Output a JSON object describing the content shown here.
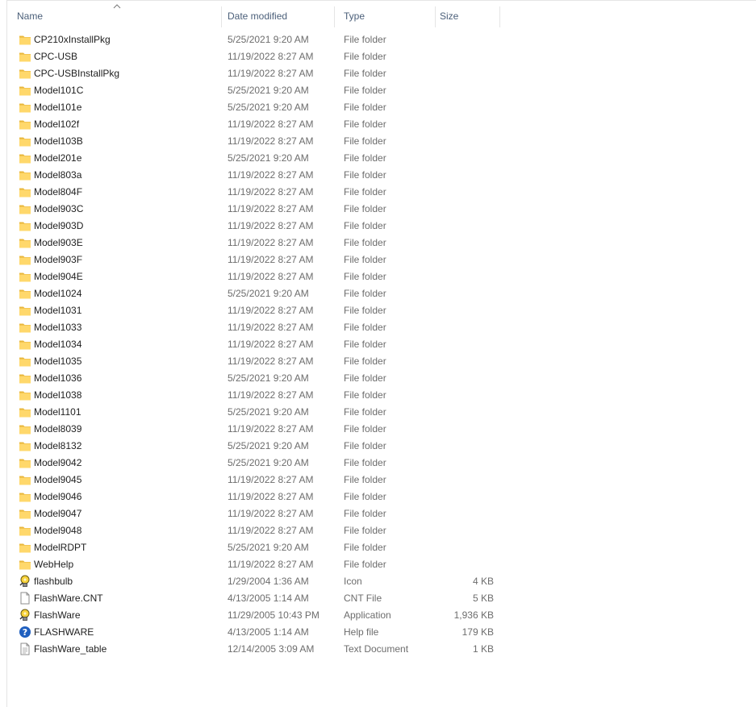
{
  "columns": {
    "name": "Name",
    "date": "Date modified",
    "type": "Type",
    "size": "Size"
  },
  "sort": {
    "column": "name",
    "direction": "ascending",
    "icon": "sort-up-arrow-icon"
  },
  "colors": {
    "header_text": "#4c607a",
    "name_text": "#1e1e1e",
    "detail_text": "#6d6d6d",
    "folder_fill": "#ffd86b",
    "folder_dark": "#e8b73c"
  },
  "files": [
    {
      "name": "CP210xInstallPkg",
      "date": "5/25/2021 9:20 AM",
      "type": "File folder",
      "size": "",
      "icon": "folder"
    },
    {
      "name": "CPC-USB",
      "date": "11/19/2022 8:27 AM",
      "type": "File folder",
      "size": "",
      "icon": "folder"
    },
    {
      "name": "CPC-USBInstallPkg",
      "date": "11/19/2022 8:27 AM",
      "type": "File folder",
      "size": "",
      "icon": "folder"
    },
    {
      "name": "Model101C",
      "date": "5/25/2021 9:20 AM",
      "type": "File folder",
      "size": "",
      "icon": "folder"
    },
    {
      "name": "Model101e",
      "date": "5/25/2021 9:20 AM",
      "type": "File folder",
      "size": "",
      "icon": "folder"
    },
    {
      "name": "Model102f",
      "date": "11/19/2022 8:27 AM",
      "type": "File folder",
      "size": "",
      "icon": "folder"
    },
    {
      "name": "Model103B",
      "date": "11/19/2022 8:27 AM",
      "type": "File folder",
      "size": "",
      "icon": "folder"
    },
    {
      "name": "Model201e",
      "date": "5/25/2021 9:20 AM",
      "type": "File folder",
      "size": "",
      "icon": "folder"
    },
    {
      "name": "Model803a",
      "date": "11/19/2022 8:27 AM",
      "type": "File folder",
      "size": "",
      "icon": "folder"
    },
    {
      "name": "Model804F",
      "date": "11/19/2022 8:27 AM",
      "type": "File folder",
      "size": "",
      "icon": "folder"
    },
    {
      "name": "Model903C",
      "date": "11/19/2022 8:27 AM",
      "type": "File folder",
      "size": "",
      "icon": "folder"
    },
    {
      "name": "Model903D",
      "date": "11/19/2022 8:27 AM",
      "type": "File folder",
      "size": "",
      "icon": "folder"
    },
    {
      "name": "Model903E",
      "date": "11/19/2022 8:27 AM",
      "type": "File folder",
      "size": "",
      "icon": "folder"
    },
    {
      "name": "Model903F",
      "date": "11/19/2022 8:27 AM",
      "type": "File folder",
      "size": "",
      "icon": "folder"
    },
    {
      "name": "Model904E",
      "date": "11/19/2022 8:27 AM",
      "type": "File folder",
      "size": "",
      "icon": "folder"
    },
    {
      "name": "Model1024",
      "date": "5/25/2021 9:20 AM",
      "type": "File folder",
      "size": "",
      "icon": "folder"
    },
    {
      "name": "Model1031",
      "date": "11/19/2022 8:27 AM",
      "type": "File folder",
      "size": "",
      "icon": "folder"
    },
    {
      "name": "Model1033",
      "date": "11/19/2022 8:27 AM",
      "type": "File folder",
      "size": "",
      "icon": "folder"
    },
    {
      "name": "Model1034",
      "date": "11/19/2022 8:27 AM",
      "type": "File folder",
      "size": "",
      "icon": "folder"
    },
    {
      "name": "Model1035",
      "date": "11/19/2022 8:27 AM",
      "type": "File folder",
      "size": "",
      "icon": "folder"
    },
    {
      "name": "Model1036",
      "date": "5/25/2021 9:20 AM",
      "type": "File folder",
      "size": "",
      "icon": "folder"
    },
    {
      "name": "Model1038",
      "date": "11/19/2022 8:27 AM",
      "type": "File folder",
      "size": "",
      "icon": "folder"
    },
    {
      "name": "Model1101",
      "date": "5/25/2021 9:20 AM",
      "type": "File folder",
      "size": "",
      "icon": "folder"
    },
    {
      "name": "Model8039",
      "date": "11/19/2022 8:27 AM",
      "type": "File folder",
      "size": "",
      "icon": "folder"
    },
    {
      "name": "Model8132",
      "date": "5/25/2021 9:20 AM",
      "type": "File folder",
      "size": "",
      "icon": "folder"
    },
    {
      "name": "Model9042",
      "date": "5/25/2021 9:20 AM",
      "type": "File folder",
      "size": "",
      "icon": "folder"
    },
    {
      "name": "Model9045",
      "date": "11/19/2022 8:27 AM",
      "type": "File folder",
      "size": "",
      "icon": "folder"
    },
    {
      "name": "Model9046",
      "date": "11/19/2022 8:27 AM",
      "type": "File folder",
      "size": "",
      "icon": "folder"
    },
    {
      "name": "Model9047",
      "date": "11/19/2022 8:27 AM",
      "type": "File folder",
      "size": "",
      "icon": "folder"
    },
    {
      "name": "Model9048",
      "date": "11/19/2022 8:27 AM",
      "type": "File folder",
      "size": "",
      "icon": "folder"
    },
    {
      "name": "ModelRDPT",
      "date": "5/25/2021 9:20 AM",
      "type": "File folder",
      "size": "",
      "icon": "folder"
    },
    {
      "name": "WebHelp",
      "date": "11/19/2022 8:27 AM",
      "type": "File folder",
      "size": "",
      "icon": "folder"
    },
    {
      "name": "flashbulb",
      "date": "1/29/2004 1:36 AM",
      "type": "Icon",
      "size": "4 KB",
      "icon": "flashbulb"
    },
    {
      "name": "FlashWare.CNT",
      "date": "4/13/2005 1:14 AM",
      "type": "CNT File",
      "size": "5 KB",
      "icon": "blank-file"
    },
    {
      "name": "FlashWare",
      "date": "11/29/2005 10:43 PM",
      "type": "Application",
      "size": "1,936 KB",
      "icon": "flashbulb"
    },
    {
      "name": "FLASHWARE",
      "date": "4/13/2005 1:14 AM",
      "type": "Help file",
      "size": "179 KB",
      "icon": "help"
    },
    {
      "name": "FlashWare_table",
      "date": "12/14/2005 3:09 AM",
      "type": "Text Document",
      "size": "1 KB",
      "icon": "text-file"
    }
  ]
}
